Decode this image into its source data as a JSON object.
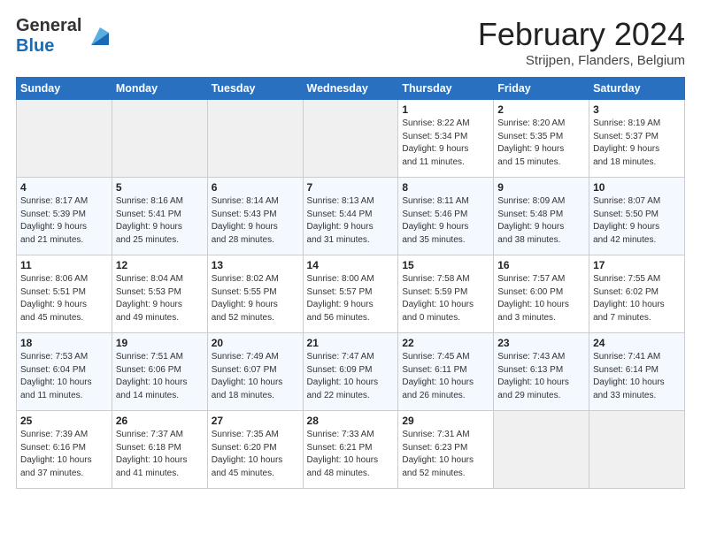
{
  "header": {
    "logo_line1": "General",
    "logo_line2": "Blue",
    "cal_title": "February 2024",
    "cal_subtitle": "Strijpen, Flanders, Belgium"
  },
  "days_of_week": [
    "Sunday",
    "Monday",
    "Tuesday",
    "Wednesday",
    "Thursday",
    "Friday",
    "Saturday"
  ],
  "weeks": [
    [
      {
        "day": "",
        "info": ""
      },
      {
        "day": "",
        "info": ""
      },
      {
        "day": "",
        "info": ""
      },
      {
        "day": "",
        "info": ""
      },
      {
        "day": "1",
        "info": "Sunrise: 8:22 AM\nSunset: 5:34 PM\nDaylight: 9 hours\nand 11 minutes."
      },
      {
        "day": "2",
        "info": "Sunrise: 8:20 AM\nSunset: 5:35 PM\nDaylight: 9 hours\nand 15 minutes."
      },
      {
        "day": "3",
        "info": "Sunrise: 8:19 AM\nSunset: 5:37 PM\nDaylight: 9 hours\nand 18 minutes."
      }
    ],
    [
      {
        "day": "4",
        "info": "Sunrise: 8:17 AM\nSunset: 5:39 PM\nDaylight: 9 hours\nand 21 minutes."
      },
      {
        "day": "5",
        "info": "Sunrise: 8:16 AM\nSunset: 5:41 PM\nDaylight: 9 hours\nand 25 minutes."
      },
      {
        "day": "6",
        "info": "Sunrise: 8:14 AM\nSunset: 5:43 PM\nDaylight: 9 hours\nand 28 minutes."
      },
      {
        "day": "7",
        "info": "Sunrise: 8:13 AM\nSunset: 5:44 PM\nDaylight: 9 hours\nand 31 minutes."
      },
      {
        "day": "8",
        "info": "Sunrise: 8:11 AM\nSunset: 5:46 PM\nDaylight: 9 hours\nand 35 minutes."
      },
      {
        "day": "9",
        "info": "Sunrise: 8:09 AM\nSunset: 5:48 PM\nDaylight: 9 hours\nand 38 minutes."
      },
      {
        "day": "10",
        "info": "Sunrise: 8:07 AM\nSunset: 5:50 PM\nDaylight: 9 hours\nand 42 minutes."
      }
    ],
    [
      {
        "day": "11",
        "info": "Sunrise: 8:06 AM\nSunset: 5:51 PM\nDaylight: 9 hours\nand 45 minutes."
      },
      {
        "day": "12",
        "info": "Sunrise: 8:04 AM\nSunset: 5:53 PM\nDaylight: 9 hours\nand 49 minutes."
      },
      {
        "day": "13",
        "info": "Sunrise: 8:02 AM\nSunset: 5:55 PM\nDaylight: 9 hours\nand 52 minutes."
      },
      {
        "day": "14",
        "info": "Sunrise: 8:00 AM\nSunset: 5:57 PM\nDaylight: 9 hours\nand 56 minutes."
      },
      {
        "day": "15",
        "info": "Sunrise: 7:58 AM\nSunset: 5:59 PM\nDaylight: 10 hours\nand 0 minutes."
      },
      {
        "day": "16",
        "info": "Sunrise: 7:57 AM\nSunset: 6:00 PM\nDaylight: 10 hours\nand 3 minutes."
      },
      {
        "day": "17",
        "info": "Sunrise: 7:55 AM\nSunset: 6:02 PM\nDaylight: 10 hours\nand 7 minutes."
      }
    ],
    [
      {
        "day": "18",
        "info": "Sunrise: 7:53 AM\nSunset: 6:04 PM\nDaylight: 10 hours\nand 11 minutes."
      },
      {
        "day": "19",
        "info": "Sunrise: 7:51 AM\nSunset: 6:06 PM\nDaylight: 10 hours\nand 14 minutes."
      },
      {
        "day": "20",
        "info": "Sunrise: 7:49 AM\nSunset: 6:07 PM\nDaylight: 10 hours\nand 18 minutes."
      },
      {
        "day": "21",
        "info": "Sunrise: 7:47 AM\nSunset: 6:09 PM\nDaylight: 10 hours\nand 22 minutes."
      },
      {
        "day": "22",
        "info": "Sunrise: 7:45 AM\nSunset: 6:11 PM\nDaylight: 10 hours\nand 26 minutes."
      },
      {
        "day": "23",
        "info": "Sunrise: 7:43 AM\nSunset: 6:13 PM\nDaylight: 10 hours\nand 29 minutes."
      },
      {
        "day": "24",
        "info": "Sunrise: 7:41 AM\nSunset: 6:14 PM\nDaylight: 10 hours\nand 33 minutes."
      }
    ],
    [
      {
        "day": "25",
        "info": "Sunrise: 7:39 AM\nSunset: 6:16 PM\nDaylight: 10 hours\nand 37 minutes."
      },
      {
        "day": "26",
        "info": "Sunrise: 7:37 AM\nSunset: 6:18 PM\nDaylight: 10 hours\nand 41 minutes."
      },
      {
        "day": "27",
        "info": "Sunrise: 7:35 AM\nSunset: 6:20 PM\nDaylight: 10 hours\nand 45 minutes."
      },
      {
        "day": "28",
        "info": "Sunrise: 7:33 AM\nSunset: 6:21 PM\nDaylight: 10 hours\nand 48 minutes."
      },
      {
        "day": "29",
        "info": "Sunrise: 7:31 AM\nSunset: 6:23 PM\nDaylight: 10 hours\nand 52 minutes."
      },
      {
        "day": "",
        "info": ""
      },
      {
        "day": "",
        "info": ""
      }
    ]
  ]
}
